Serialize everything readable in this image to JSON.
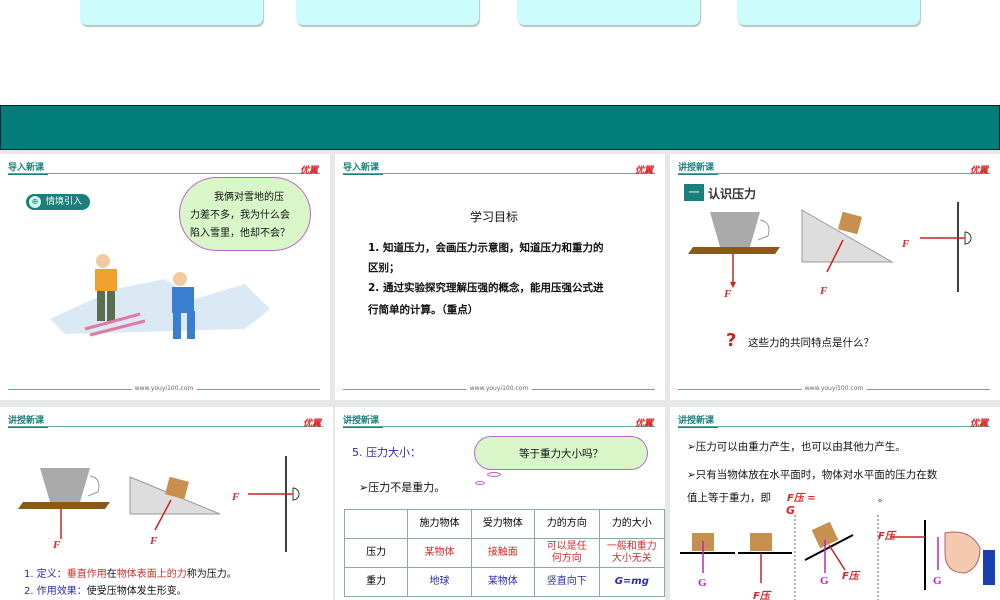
{
  "site": "www.youyi100.com",
  "logo": "优翼",
  "headers": {
    "intro": "导入新课",
    "teach": "讲授新课"
  },
  "slide1": {
    "tag": "情境引入",
    "bubble": [
      "我俩对雪地的压",
      "力差不多，我为什么会",
      "陷入雪里，他却不会？"
    ]
  },
  "slide2": {
    "title": "学习目标",
    "lines": [
      "1. 知道压力，会画压力示意图，知道压力和重力的",
      "区别；",
      "2. 通过实验探究理解压强的概念，能用压强公式进",
      "行简单的计算。（重点）"
    ]
  },
  "slide3": {
    "section_num": "一",
    "section": "认识压力",
    "force": "F",
    "question": "这些力的共同特点是什么？"
  },
  "slide4": {
    "force": "F",
    "def_prefix": "1. 定义：",
    "def_a": "垂直作用",
    "def_b": "在",
    "def_c": "物体表面上的力",
    "def_d": "称为压力。",
    "effect_prefix": "2. 作用效果：",
    "effect": "使受压物体发生形变。"
  },
  "slide5": {
    "heading": "5. 压力大小：",
    "bubble": "等于重力大小吗？",
    "point": "➢压力不是重力。",
    "table": {
      "headers": [
        "",
        "施力物体",
        "受力物体",
        "力的方向",
        "力的大小"
      ],
      "rows": [
        [
          "压力",
          "某物体",
          "接触面",
          "可以是任何方向",
          "一般和重力大小无关"
        ],
        [
          "重力",
          "地球",
          "某物体",
          "竖直向下",
          "G=mg"
        ]
      ]
    }
  },
  "slide6": {
    "line1": "➢压力可以由重力产生，也可以由其他力产生。",
    "line2": "➢只有当物体放在水平面时，物体对水平面的压力在数",
    "line3": "值上等于重力，即",
    "formula": "F压 =",
    "blank": "。",
    "g": "G",
    "fp": "F压"
  },
  "colors": {
    "teal": "#037d7a",
    "red": "#d32b2b",
    "blue": "#2a2ab0",
    "magenta": "#c020c0"
  }
}
